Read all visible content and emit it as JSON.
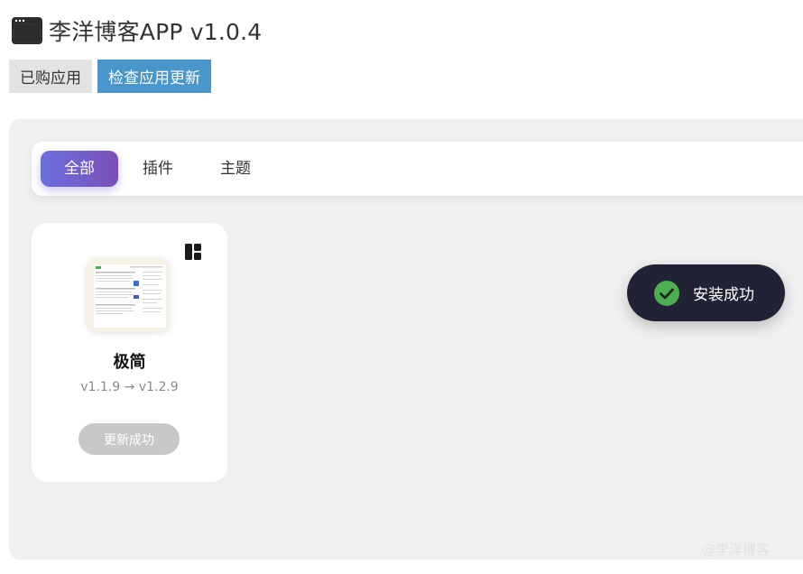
{
  "header": {
    "title": "李洋博客APP v1.0.4",
    "icon": "browser-window-icon"
  },
  "actions": {
    "purchased_label": "已购应用",
    "check_update_label": "检查应用更新"
  },
  "tabs": [
    {
      "label": "全部",
      "active": true
    },
    {
      "label": "插件",
      "active": false
    },
    {
      "label": "主题",
      "active": false
    }
  ],
  "apps": [
    {
      "name": "极简",
      "version": "v1.1.9 → v1.2.9",
      "button_label": "更新成功",
      "type_icon": "layout-grid-icon"
    }
  ],
  "toast": {
    "text": "安装成功",
    "icon": "check-circle-icon"
  },
  "watermark": "@李洋博客",
  "colors": {
    "primary_button": "#4a95c9",
    "tab_active_start": "#6a6fe0",
    "tab_active_end": "#7b4fb6",
    "toast_bg": "#222236",
    "success": "#4caf50"
  }
}
